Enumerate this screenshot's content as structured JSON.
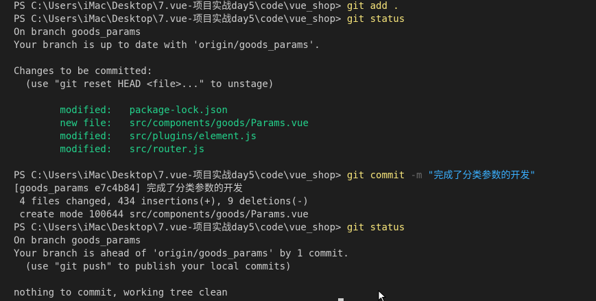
{
  "terminal": {
    "prompt1": "PS C:\\Users\\iMac\\Desktop\\7.vue-项目实战day5\\code\\vue_shop> ",
    "cmd1": "git add .",
    "prompt2": "PS C:\\Users\\iMac\\Desktop\\7.vue-项目实战day5\\code\\vue_shop> ",
    "cmd2": "git status",
    "branch_line": "On branch goods_params",
    "uptodate_line": "Your branch is up to date with 'origin/goods_params'.",
    "changes_header": "Changes to be committed:",
    "unstage_hint": "  (use \"git reset HEAD <file>...\" to unstage)",
    "changes": [
      {
        "status": "        modified:   ",
        "file": "package-lock.json"
      },
      {
        "status": "        new file:   ",
        "file": "src/components/goods/Params.vue"
      },
      {
        "status": "        modified:   ",
        "file": "src/plugins/element.js"
      },
      {
        "status": "        modified:   ",
        "file": "src/router.js"
      }
    ],
    "prompt3": "PS C:\\Users\\iMac\\Desktop\\7.vue-项目实战day5\\code\\vue_shop> ",
    "cmd3": "git commit",
    "cmd3_flag": "-m",
    "cmd3_msg": "\"完成了分类参数的开发\"",
    "commit_result": "[goods_params e7c4b84] 完成了分类参数的开发",
    "commit_stats": " 4 files changed, 434 insertions(+), 9 deletions(-)",
    "create_mode": " create mode 100644 src/components/goods/Params.vue",
    "prompt4": "PS C:\\Users\\iMac\\Desktop\\7.vue-项目实战day5\\code\\vue_shop> ",
    "cmd4": "git status",
    "branch_line2": "On branch goods_params",
    "ahead_line": "Your branch is ahead of 'origin/goods_params' by 1 commit.",
    "push_hint": "  (use \"git push\" to publish your local commits)",
    "clean_line": "nothing to commit, working tree clean"
  },
  "colors": {
    "background": "#1e1e1e",
    "text": "#cccccc",
    "command": "#f5e37a",
    "green": "#23d18b",
    "flag": "#6a6a6a",
    "string": "#3ab0ff"
  }
}
